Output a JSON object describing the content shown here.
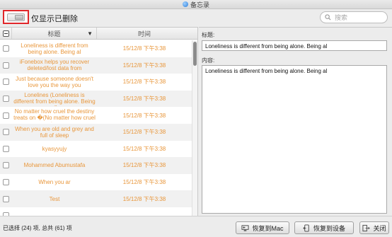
{
  "window": {
    "title": "备忘录"
  },
  "toolbar": {
    "toggle_label": "仅显示已删除",
    "search_placeholder": "搜索"
  },
  "list": {
    "header": {
      "title_col": "标题",
      "time_col": "时间"
    },
    "rows": [
      {
        "title": "Loneliness is different from being alone. Being al",
        "time": "15/12/8 下午3:38"
      },
      {
        "title": "iFonebox helps you recover deleted/lost data from",
        "time": "15/12/8 下午3:38"
      },
      {
        "title": "Just because someone doesn't love you the way you",
        "time": "15/12/8 下午3:38"
      },
      {
        "title": "Lonelines (Loneliness is different from being alone. Being al)",
        "time": "15/12/8 下午3:38"
      },
      {
        "title": "No matter how cruel the destiny treats on �(No matter how cruel t…",
        "time": "15/12/8 下午3:38"
      },
      {
        "title": "When you are old and grey and full of sleep",
        "time": "15/12/8 下午3:38"
      },
      {
        "title": "kyasyyujy",
        "time": "15/12/8 下午3:38"
      },
      {
        "title": "Mohammed Abumustafa",
        "time": "15/12/8 下午3:38"
      },
      {
        "title": "When you ar",
        "time": "15/12/8 下午3:38"
      },
      {
        "title": "Test",
        "time": "15/12/8 下午3:38"
      },
      {
        "title": "",
        "time": ""
      }
    ]
  },
  "detail": {
    "title_label": "标题:",
    "title_value": "Loneliness is different from being alone. Being al",
    "content_label": "内容:",
    "content_value": "Loneliness is different from being alone. Being al"
  },
  "footer": {
    "status": "已选择 (24) 项, 总共 (61) 项",
    "restore_mac_label": "恢复到Mac",
    "restore_device_label": "恢复到设备",
    "close_label": "关闭"
  },
  "colors": {
    "row_text": "#e8963a",
    "highlight_border": "#e0262a"
  }
}
